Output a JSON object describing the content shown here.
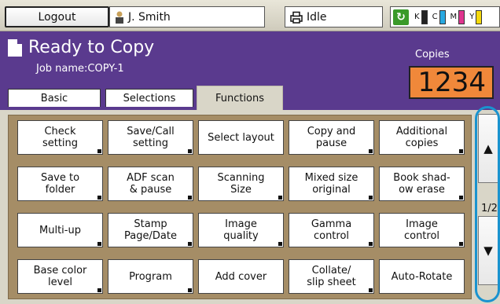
{
  "topbar": {
    "logout_label": "Logout",
    "user_name": "J. Smith",
    "status": "Idle",
    "inks": [
      {
        "label": "K",
        "color": "#222222"
      },
      {
        "label": "C",
        "color": "#29a8e0"
      },
      {
        "label": "M",
        "color": "#e0358f"
      },
      {
        "label": "Y",
        "color": "#f4d90c"
      }
    ]
  },
  "header": {
    "title": "Ready to Copy",
    "job_name": "Job name:COPY-1",
    "copies_label": "Copies",
    "copies_value": "1234"
  },
  "tabs": [
    {
      "label": "Basic"
    },
    {
      "label": "Selections"
    },
    {
      "label": "Functions"
    }
  ],
  "functions": [
    {
      "label": "Check\nsetting"
    },
    {
      "label": "Save/Call\nsetting"
    },
    {
      "label": "Select layout"
    },
    {
      "label": "Copy and\npause"
    },
    {
      "label": "Additional\ncopies"
    },
    {
      "label": "Save to\nfolder"
    },
    {
      "label": "ADF scan\n& pause"
    },
    {
      "label": "Scanning\nSize"
    },
    {
      "label": "Mixed size\noriginal"
    },
    {
      "label": "Book shad-\now erase"
    },
    {
      "label": "Multi-up"
    },
    {
      "label": "Stamp\nPage/Date"
    },
    {
      "label": "Image\nquality"
    },
    {
      "label": "Gamma\ncontrol"
    },
    {
      "label": "Image\ncontrol"
    },
    {
      "label": "Base color\nlevel"
    },
    {
      "label": "Program"
    },
    {
      "label": "Add cover"
    },
    {
      "label": "Collate/\nslip sheet"
    },
    {
      "label": "Auto-Rotate"
    }
  ],
  "pager": {
    "indicator": "1/2",
    "up_label": "▲",
    "down_label": "▼"
  }
}
